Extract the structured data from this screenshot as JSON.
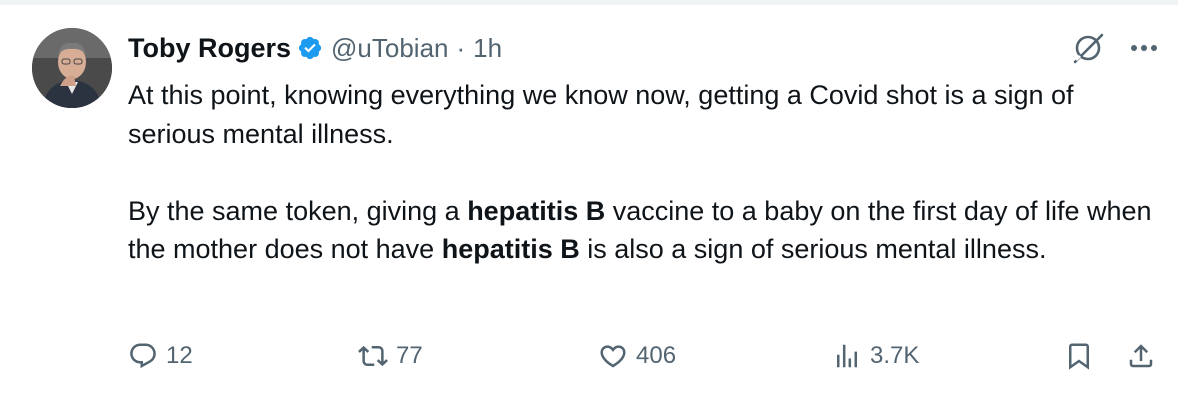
{
  "tweet": {
    "author_name": "Toby Rogers",
    "handle": "@uTobian",
    "separator": "·",
    "time": "1h",
    "paragraph1": "At this point, knowing everything we know now, getting a Covid shot is a sign of serious mental illness.",
    "p2_part1": "By the same token, giving a ",
    "p2_bold1": "hepatitis B",
    "p2_part2": " vaccine to a baby on the first day of life when the mother does not have ",
    "p2_bold2": "hepatitis B",
    "p2_part3": " is also a sign of serious mental illness."
  },
  "actions": {
    "reply_count": "12",
    "retweet_count": "77",
    "like_count": "406",
    "views_count": "3.7K"
  },
  "icons": {
    "verified": "verified-badge-icon",
    "grok": "grok-icon",
    "more": "more-icon",
    "reply": "reply-icon",
    "retweet": "retweet-icon",
    "like": "heart-icon",
    "views": "views-icon",
    "bookmark": "bookmark-icon",
    "share": "share-icon"
  },
  "colors": {
    "text": "#0f1419",
    "secondary": "#536471",
    "verified": "#1d9bf0"
  }
}
